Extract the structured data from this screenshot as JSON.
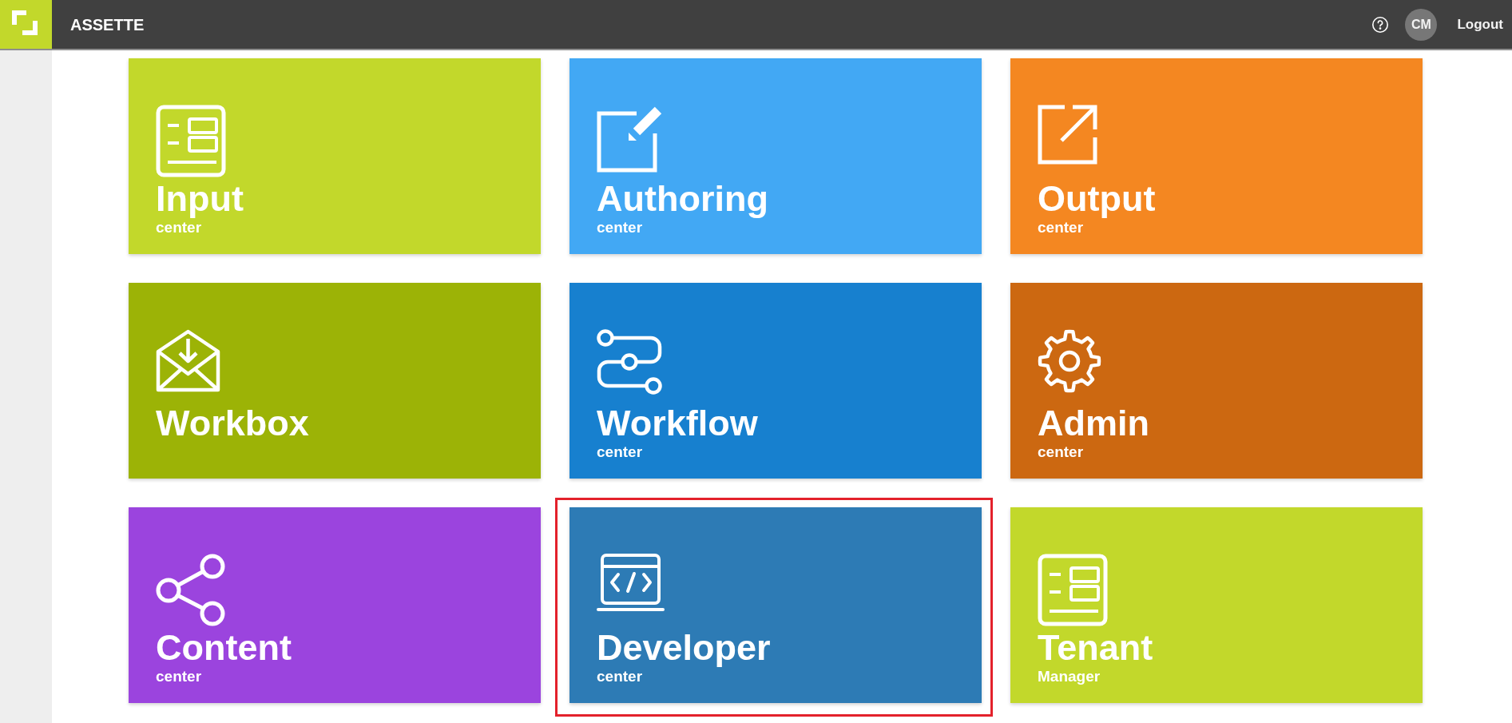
{
  "header": {
    "app_title": "ASSETTE",
    "avatar": "CM",
    "logout": "Logout"
  },
  "tiles": [
    {
      "title": "Input",
      "subtitle": "center",
      "color": "#c2d82b",
      "highlighted": false
    },
    {
      "title": "Authoring",
      "subtitle": "center",
      "color": "#42a8f4",
      "highlighted": false
    },
    {
      "title": "Output",
      "subtitle": "center",
      "color": "#f48721",
      "highlighted": false
    },
    {
      "title": "Workbox",
      "color": "#9cb306",
      "highlighted": false
    },
    {
      "title": "Workflow",
      "subtitle": "center",
      "color": "#1780cf",
      "highlighted": false
    },
    {
      "title": "Admin",
      "subtitle": "center",
      "color": "#cc6811",
      "highlighted": false
    },
    {
      "title": "Content",
      "subtitle": "center",
      "color": "#9b44de",
      "highlighted": false
    },
    {
      "title": "Developer",
      "subtitle": "center",
      "color": "#2d7bb5",
      "highlighted": true
    },
    {
      "title": "Tenant",
      "subtitle": "Manager",
      "color": "#c2d82b",
      "highlighted": false
    }
  ]
}
